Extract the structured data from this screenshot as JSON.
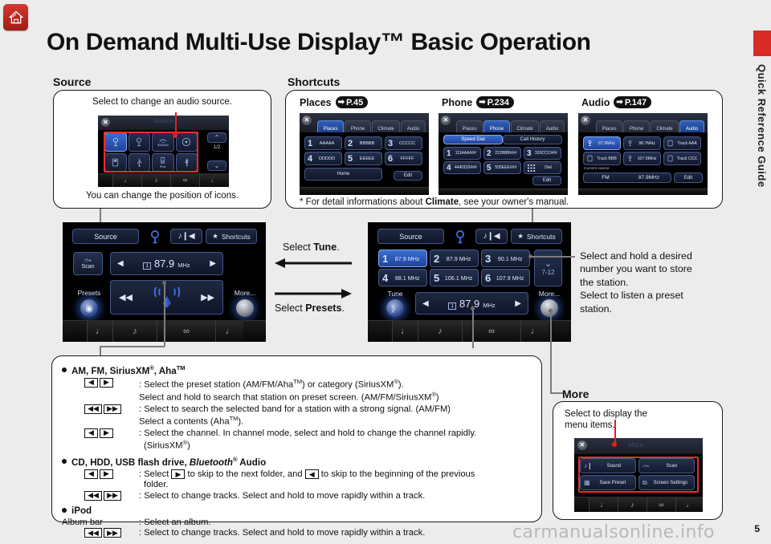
{
  "page": {
    "title": "On Demand Multi-Use Display™ Basic Operation",
    "sidebar_label": "Quick Reference Guide",
    "page_number": "5",
    "watermark": "carmanualsonline.info",
    "home_icon": "home-icon"
  },
  "source_section": {
    "caption": "Source",
    "note_top": "Select to change an audio source.",
    "note_bottom": "You can change the position of icons.",
    "screen": {
      "header": "Source",
      "close": "✕",
      "page_indicator": "1/2",
      "scroll_up": "up-chevron-icon",
      "scroll_down": "down-chevron-icon",
      "icons": [
        {
          "name": "fm-icon",
          "label": ""
        },
        {
          "name": "am-icon",
          "label": ""
        },
        {
          "name": "siriusxm-icon",
          "label": "SiriusXM"
        },
        {
          "name": "disc-icon",
          "label": ""
        },
        {
          "name": "hdd-icon",
          "label": ""
        },
        {
          "name": "usb-icon",
          "label": ""
        },
        {
          "name": "ipod-icon",
          "label": "iPod"
        },
        {
          "name": "bluetooth-icon",
          "label": ""
        }
      ]
    }
  },
  "shortcuts_section": {
    "caption": "Shortcuts",
    "footnote_pre": "* For detail informations about ",
    "footnote_bold": "Climate",
    "footnote_post": ", see your owner's manual.",
    "groups": [
      {
        "title": "Places",
        "ref_arrow": "➡",
        "ref_p": "P.",
        "ref_num": "45",
        "tabs": [
          "Places",
          "Phone",
          "Climate",
          "Audio"
        ],
        "active_tab": "Places",
        "cells": [
          {
            "num": "1",
            "label": "AAAAA"
          },
          {
            "num": "2",
            "label": "BBBBB"
          },
          {
            "num": "3",
            "label": "CCCCC"
          },
          {
            "num": "4",
            "label": "DDDDD"
          },
          {
            "num": "5",
            "label": "EEEEE"
          },
          {
            "num": "6",
            "label": "FFFFF"
          }
        ],
        "home_row": "Home",
        "edit": "Edit"
      },
      {
        "title": "Phone",
        "ref_arrow": "➡",
        "ref_p": "P.",
        "ref_num": "234",
        "tabs": [
          "Places",
          "Phone",
          "Climate",
          "Audio"
        ],
        "active_tab": "Phone",
        "toggle_left": "Speed Dial",
        "toggle_right": "Call History",
        "cells": [
          {
            "num": "1",
            "label": "111AAA###"
          },
          {
            "num": "2",
            "label": "222BBB###"
          },
          {
            "num": "3",
            "label": "333CCC###"
          },
          {
            "num": "4",
            "label": "444DDD###"
          },
          {
            "num": "5",
            "label": "555EEE###"
          },
          {
            "num": "",
            "label": "Dial"
          }
        ],
        "edit": "Edit"
      },
      {
        "title": "Audio",
        "ref_arrow": "➡",
        "ref_p": "P.",
        "ref_num": "147",
        "tabs": [
          "Places",
          "Phone",
          "Climate",
          "Audio"
        ],
        "active_tab": "Audio",
        "cells": [
          {
            "num": "",
            "label": "87.9MHz"
          },
          {
            "num": "",
            "label": "98.7MHz"
          },
          {
            "num": "",
            "label": "Track AAA"
          },
          {
            "num": "",
            "label": "Track BBB"
          },
          {
            "num": "",
            "label": "107.9MHz"
          },
          {
            "num": "",
            "label": "Track CCC"
          }
        ],
        "current_source_label": "Current source",
        "current_source_band": "FM",
        "current_source_freq": "87.9MHz",
        "edit": "Edit"
      }
    ]
  },
  "radio_left": {
    "source_btn": "Source",
    "band_icon": "fm-icon",
    "sound_icon": "sound-icon",
    "shortcuts_btn": "Shortcuts",
    "shortcuts_star": "★",
    "scan_btn": "Scan",
    "preset_index": "1",
    "frequency": "87.9",
    "freq_unit": "MHz",
    "prev_arrow": "◀",
    "next_arrow": "▶",
    "presets_label": "Presets",
    "seek_prev": "◀◀",
    "seek_next": "▶▶",
    "more_label": "More...",
    "antenna_icon": "antenna-icon"
  },
  "radio_right": {
    "source_btn": "Source",
    "band_icon": "fm-icon",
    "sound_icon": "sound-icon",
    "shortcuts_btn": "Shortcuts",
    "shortcuts_star": "★",
    "presets": [
      {
        "num": "1",
        "label": "87.9 MHz",
        "selected": true
      },
      {
        "num": "2",
        "label": "87.9 MHz",
        "selected": false
      },
      {
        "num": "3",
        "label": "90.1 MHz",
        "selected": false
      },
      {
        "num": "4",
        "label": "98.1 MHz",
        "selected": false
      },
      {
        "num": "5",
        "label": "106.1 MHz",
        "selected": false
      },
      {
        "num": "6",
        "label": "107.9 MHz",
        "selected": false
      }
    ],
    "page_next": "7-12",
    "tune_label": "Tune",
    "preset_index": "1",
    "frequency": "87.9",
    "freq_unit": "MHz",
    "prev_arrow": "◀",
    "next_arrow": "▶",
    "more_label": "More..."
  },
  "middle_callouts": {
    "top_pre": "Select ",
    "top_bold": "Tune",
    "top_post": ".",
    "bottom_pre": "Select ",
    "bottom_bold": "Presets",
    "bottom_post": "."
  },
  "right_callout": {
    "line1": "Select and hold a desired",
    "line2": "number you want to store",
    "line3": "the station.",
    "line4": "Select to listen a preset",
    "line5": "station."
  },
  "more_section": {
    "caption": "More",
    "note_line1": "Select to display the",
    "note_line2": "menu items.",
    "screen": {
      "header": "More...",
      "close": "✕",
      "items": [
        {
          "icon": "sound-icon",
          "label": "Sound"
        },
        {
          "icon": "scan-icon",
          "label": "Scan"
        },
        {
          "icon": "save-preset-icon",
          "label": "Save Preset"
        },
        {
          "icon": "screen-settings-icon",
          "label": "Screen Settings"
        }
      ]
    }
  },
  "notes": {
    "groups": [
      {
        "heading_parts": [
          {
            "t": "AM, FM, SiriusXM",
            "sup": "®"
          },
          {
            "t": ", Aha",
            "sup": "TM"
          }
        ],
        "heading_plain": "AM, FM, SiriusXM®, AhaTM",
        "rows": [
          {
            "keys": [
              "◀",
              "▶"
            ],
            "lines": [
              ": Select the preset station (AM/FM/AhaTM) or category (SiriusXM®).",
              "Select and hold to search that station on preset screen. (AM/FM/SiriusXM®)"
            ]
          },
          {
            "keys": [
              "|◀◀",
              "▶▶|"
            ],
            "lines": [
              ": Select to search the selected band for a station with a strong signal. (AM/FM)",
              "Select a contents (AhaTM)."
            ]
          },
          {
            "keys": [
              "◀",
              "▶"
            ],
            "lines": [
              ": Select the channel. In channel mode, select and hold to change the channel rapidly.",
              "(SiriusXM®)"
            ]
          }
        ]
      },
      {
        "heading_plain": "CD, HDD, USB flash drive, Bluetooth® Audio",
        "rows": [
          {
            "keys": [
              "◀",
              "▶"
            ],
            "lines": [
              ": Select ▶ to skip to the next folder, and ◀ to skip to the beginning of the previous",
              "folder."
            ]
          },
          {
            "keys": [
              "|◀◀",
              "▶▶|"
            ],
            "lines": [
              ": Select to change tracks. Select and hold to move rapidly within a track."
            ]
          }
        ]
      },
      {
        "heading_plain": "iPod",
        "rows": [
          {
            "keys": [
              "Album bar"
            ],
            "lines": [
              ": Select an album."
            ]
          },
          {
            "keys": [
              "|◀◀",
              "▶▶|"
            ],
            "lines": [
              ": Select to change tracks. Select and hold to move rapidly within a track."
            ]
          }
        ]
      }
    ]
  }
}
